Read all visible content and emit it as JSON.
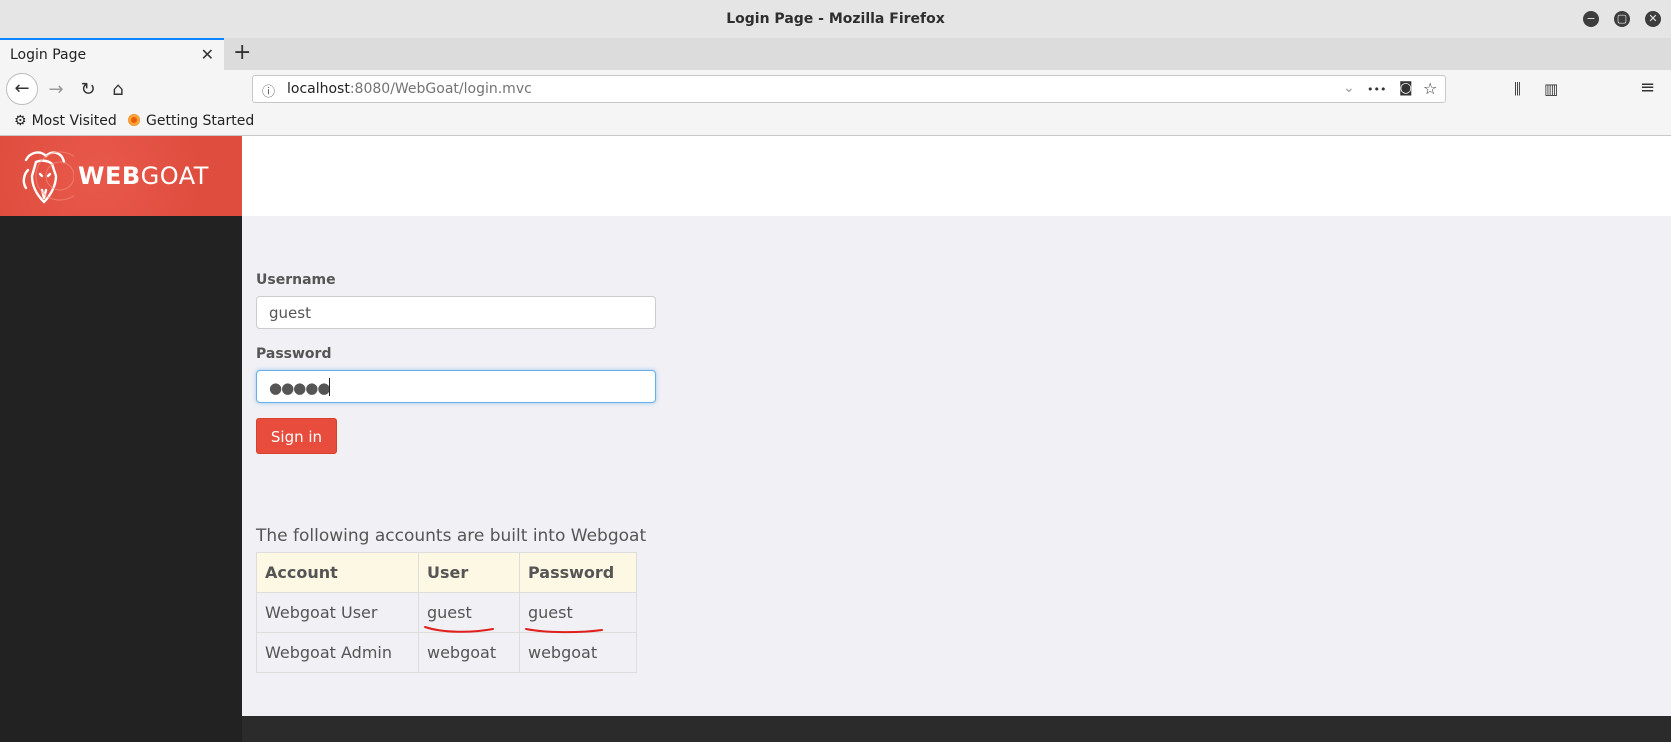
{
  "window": {
    "title": "Login Page - Mozilla Firefox",
    "minimize_glyph": "−",
    "maximize_glyph": "▢",
    "close_glyph": "✕"
  },
  "tabs": {
    "active_title": "Login Page",
    "close_glyph": "✕",
    "new_tab_glyph": "+"
  },
  "nav": {
    "back_glyph": "←",
    "forward_glyph": "→",
    "reload_glyph": "↻",
    "home_glyph": "⌂",
    "url_host": "localhost",
    "url_rest": ":8080/WebGoat/login.mvc",
    "info_glyph": "ⓘ",
    "dropdown_glyph": "⌄",
    "more_glyph": "•••",
    "pocket_glyph": "◙",
    "star_glyph": "☆",
    "library_glyph": "⫼",
    "sidebar_glyph": "▥",
    "menu_glyph": "≡"
  },
  "bookmarks": {
    "items": [
      {
        "label": "Most Visited",
        "icon": "gear-icon",
        "glyph": "⚙"
      },
      {
        "label": "Getting Started",
        "icon": "firefox-icon"
      }
    ]
  },
  "header": {
    "logo_bold": "WEB",
    "logo_rest": "GOAT",
    "brand_color": "#e74c3c"
  },
  "login": {
    "username_label": "Username",
    "username_value": "guest",
    "password_label": "Password",
    "password_masked": "●●●●●",
    "signin_label": "Sign in"
  },
  "accounts": {
    "caption": "The following accounts are built into Webgoat",
    "columns": [
      "Account",
      "User",
      "Password"
    ],
    "rows": [
      [
        "Webgoat User",
        "guest",
        "guest"
      ],
      [
        "Webgoat Admin",
        "webgoat",
        "webgoat"
      ]
    ],
    "annotation_color": "#e0201c"
  }
}
